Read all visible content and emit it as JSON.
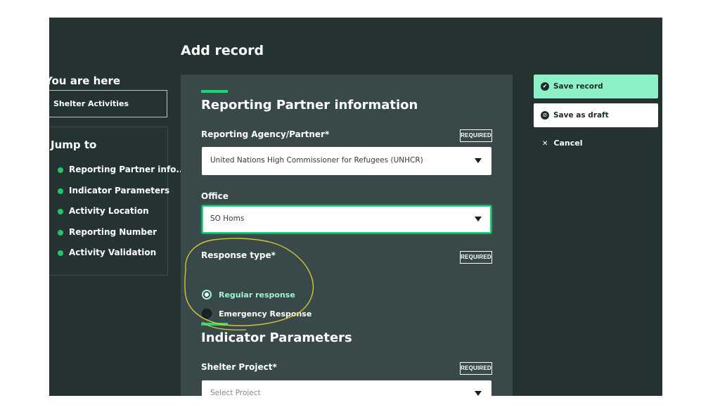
{
  "page": {
    "title": "Add record"
  },
  "nav": {
    "you_are_here": {
      "heading": "You are here",
      "item": "Shelter Activities"
    },
    "jump_to": {
      "heading": "Jump to",
      "items": [
        "Reporting Partner info...",
        "Indicator Parameters",
        "Activity Location",
        "Reporting Number",
        "Activity Validation"
      ]
    }
  },
  "form": {
    "section_reporting": {
      "title": "Reporting Partner information",
      "agency": {
        "label": "Reporting Agency/Partner*",
        "required": "REQUIRED",
        "value": "United Nations High Commissioner for Refugees (UNHCR)"
      },
      "office": {
        "label": "Office",
        "value": "SO Homs"
      },
      "response_type": {
        "label": "Response type*",
        "required": "REQUIRED",
        "options": [
          {
            "label": "Regular response",
            "selected": true
          },
          {
            "label": "Emergency Response",
            "selected": false
          }
        ]
      }
    },
    "section_indicator": {
      "title": "Indicator Parameters",
      "shelter_project": {
        "label": "Shelter Project*",
        "required": "REQUIRED",
        "placeholder": "Select Project"
      }
    }
  },
  "actions": {
    "save": "Save record",
    "draft": "Save as draft",
    "cancel": "Cancel"
  },
  "colors": {
    "background": "#253232",
    "panel": "#394949",
    "accent": "#1fd67a",
    "save_button": "#8ef0c6",
    "selected_radio_text": "#9cf5d0",
    "annotation": "#d6c43a"
  },
  "icons": {
    "save": "check-circle-icon",
    "draft": "block-circle-icon",
    "cancel": "close-icon",
    "select": "caret-down-icon"
  }
}
